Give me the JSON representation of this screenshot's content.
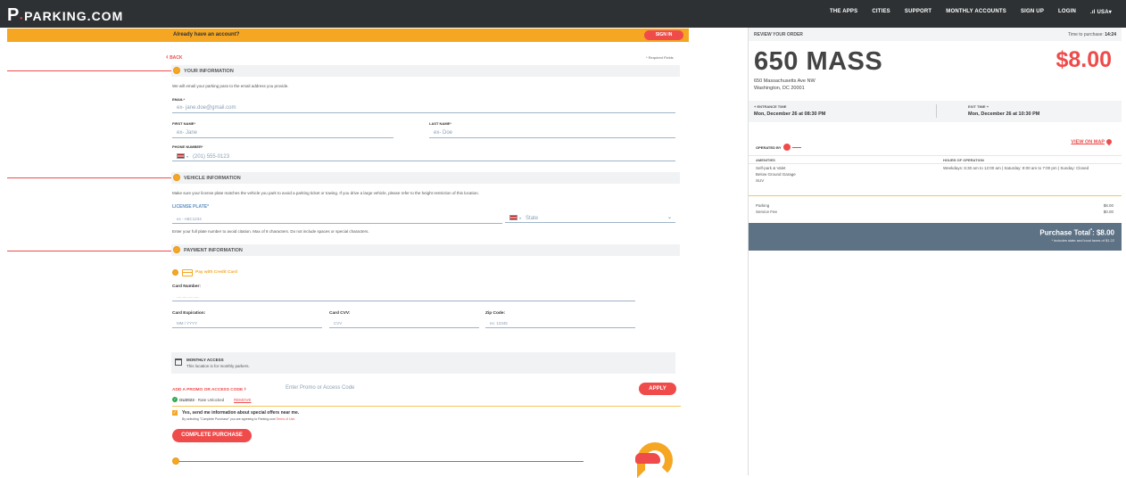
{
  "header": {
    "logo": "PARKING.COM",
    "nav": [
      "THE APPS",
      "CITIES",
      "SUPPORT",
      "MONTHLY ACCOUNTS",
      "SIGN UP",
      "LOGIN",
      "USA"
    ]
  },
  "signin_bar": {
    "text": "Already have an account?",
    "button": "SIGN IN"
  },
  "back_label": "BACK",
  "required_note": "* Required Fields",
  "sections": {
    "your_info": {
      "title": "YOUR INFORMATION",
      "desc": "We will email your parking pass to the email address you provide.",
      "email_label": "EMAIL*",
      "email_placeholder": "ex- jane.doe@gmail.com",
      "first_label": "FIRST NAME*",
      "first_placeholder": "ex- Jane",
      "last_label": "LAST NAME*",
      "last_placeholder": "ex- Doe",
      "phone_label": "PHONE NUMBER*",
      "phone_placeholder": "(201) 555-0123"
    },
    "vehicle": {
      "title": "VEHICLE INFORMATION",
      "desc": "Make sure your license plate matches the vehicle you park to avoid a parking ticket or towing. If you drive a large vehicle, please refer to the height restriction of this location.",
      "plate_label": "LICENSE PLATE*",
      "plate_placeholder": "ex - ABC1234",
      "state_placeholder": "State",
      "hint": "Enter your full plate number to avoid citation. Max of 8 characters. Do not include spaces or special characters."
    },
    "payment": {
      "title": "PAYMENT INFORMATION",
      "pay_method": "Pay with Credit Card",
      "card_number_label": "Card Number:",
      "card_number_placeholder": "---- ---- ---- ----",
      "expiration_label": "Card Expiration:",
      "expiration_placeholder": "MM / YYYY",
      "cvv_label": "Card CVV:",
      "cvv_placeholder": "CVV",
      "zip_label": "Zip Code:",
      "zip_placeholder": "ex: 12345"
    }
  },
  "monthly": {
    "title": "MONTHLY ACCESS",
    "desc": "This location is for monthly parkers."
  },
  "promo": {
    "label": "ADD A PROMO OR ACCESS CODE",
    "placeholder": "Enter Promo or Access Code",
    "apply": "APPLY",
    "code": "GU2023",
    "code_status": "· Rate Unlocked",
    "remove": "REMOVE"
  },
  "offers": {
    "label": "Yes, send me information about special offers near me.",
    "terms_prefix": "By selecting \"Complete Purchase\" you are agreeing to Parking.com",
    "terms_link": "Terms of Use."
  },
  "complete_button": "COMPLETE PURCHASE",
  "order": {
    "header": "REVIEW YOUR ORDER",
    "timer_label": "Time to purchase:",
    "timer": "14:24",
    "name": "650 MASS",
    "price": "$8.00",
    "address1": "650 Massachusetts Ave NW",
    "address2": "Washington, DC 20001",
    "entrance_label": "ENTRANCE TIME",
    "entrance": "Mon, December 26 at 08:30 PM",
    "exit_label": "EXIT TIME",
    "exit": "Mon, December 26 at 10:30 PM",
    "operated_by": "OPERATED BY",
    "view_map": "VIEW ON MAP",
    "amenities_label": "AMENITIES",
    "amenities": [
      "Self-park & Valet",
      "Below Ground Garage",
      "SUV"
    ],
    "hours_label": "HOURS OF OPERATION",
    "hours": "Weekdays: 6:30 am to 12:00 am | Saturday: 8:00 am to 7:00 pm | Sunday: Closed",
    "lines": [
      {
        "label": "Parking",
        "amount": "$8.00"
      },
      {
        "label": "Service Fee",
        "amount": "$0.00"
      }
    ],
    "total_label": "Purchase Total",
    "total": "$8.00",
    "tax_note": "* includes state and local taxes of $1.22"
  },
  "colors": {
    "accent": "#ef4b4b",
    "highlight": "#f5a623",
    "nav_bg": "#2e3133",
    "total_bg": "#5e7285"
  }
}
